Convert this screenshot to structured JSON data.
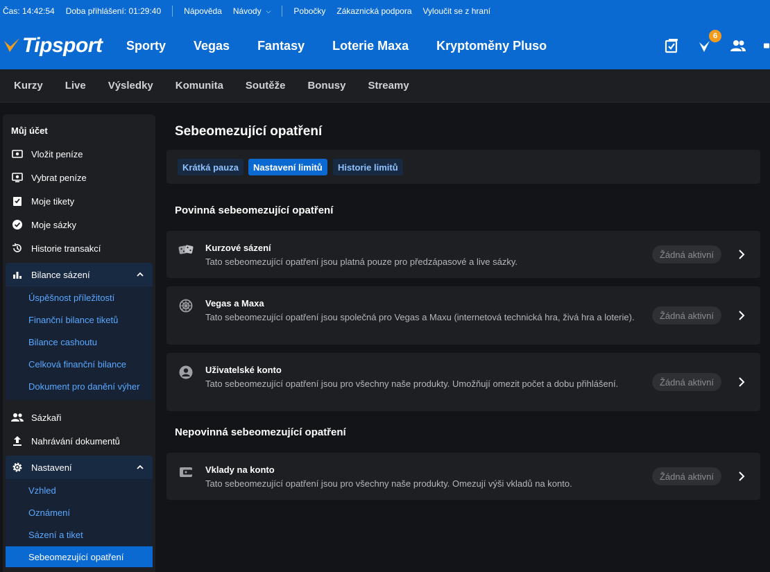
{
  "infobar": {
    "time": "Čas: 14:42:54",
    "login_duration": "Doba přihlášení: 01:29:40",
    "links": [
      "Nápověda",
      "Návody",
      "Pobočky",
      "Zákaznická podpora",
      "Vyloučit se z hraní"
    ]
  },
  "header": {
    "logo_text": "Tipsport",
    "nav": [
      "Sporty",
      "Vegas",
      "Fantasy",
      "Loterie Maxa",
      "Kryptoměny Pluso"
    ],
    "notifications_count": "6"
  },
  "subnav": [
    "Kurzy",
    "Live",
    "Výsledky",
    "Komunita",
    "Soutěže",
    "Bonusy",
    "Streamy"
  ],
  "sidebar": {
    "title": "Můj účet",
    "items": [
      "Vložit peníze",
      "Vybrat peníze",
      "Moje tikety",
      "Moje sázky",
      "Historie transakcí"
    ],
    "group_betting": {
      "label": "Bilance sázení",
      "sub": [
        "Úspěšnost příležitostí",
        "Finanční bilance tiketů",
        "Bilance cashoutu",
        "Celková finanční bilance",
        "Dokument pro danění výher"
      ]
    },
    "items2": [
      "Sázkaři",
      "Nahrávání dokumentů"
    ],
    "group_settings": {
      "label": "Nastavení",
      "sub": [
        "Vzhled",
        "Oznámení",
        "Sázení a tiket",
        "Sebeomezující opatření"
      ]
    }
  },
  "content": {
    "title": "Sebeomezující opatření",
    "tabs": [
      "Krátká pauza",
      "Nastavení limitů",
      "Historie limitů"
    ],
    "section_mandatory": "Povinná sebeomezující opatření",
    "section_optional": "Nepovinná sebeomezující opatření",
    "cards": [
      {
        "title": "Kurzové sázení",
        "desc": "Tato sebeomezující opatření jsou platná pouze pro předzápasové a live sázky.",
        "status": "Žádná aktivní"
      },
      {
        "title": "Vegas a Maxa",
        "desc": "Tato sebeomezující opatření jsou společná pro Vegas a Maxu (internetová technická hra, živá hra a loterie).",
        "status": "Žádná aktivní"
      },
      {
        "title": "Uživatelské konto",
        "desc": "Tato sebeomezující opatření jsou pro všechny naše produkty. Umožňují omezit počet a dobu přihlášení.",
        "status": "Žádná aktivní"
      },
      {
        "title": "Vklady na konto",
        "desc": "Tato sebeomezující opatření jsou pro všechny naše produkty. Omezují výši vkladů na konto.",
        "status": "Žádná aktivní"
      }
    ]
  }
}
